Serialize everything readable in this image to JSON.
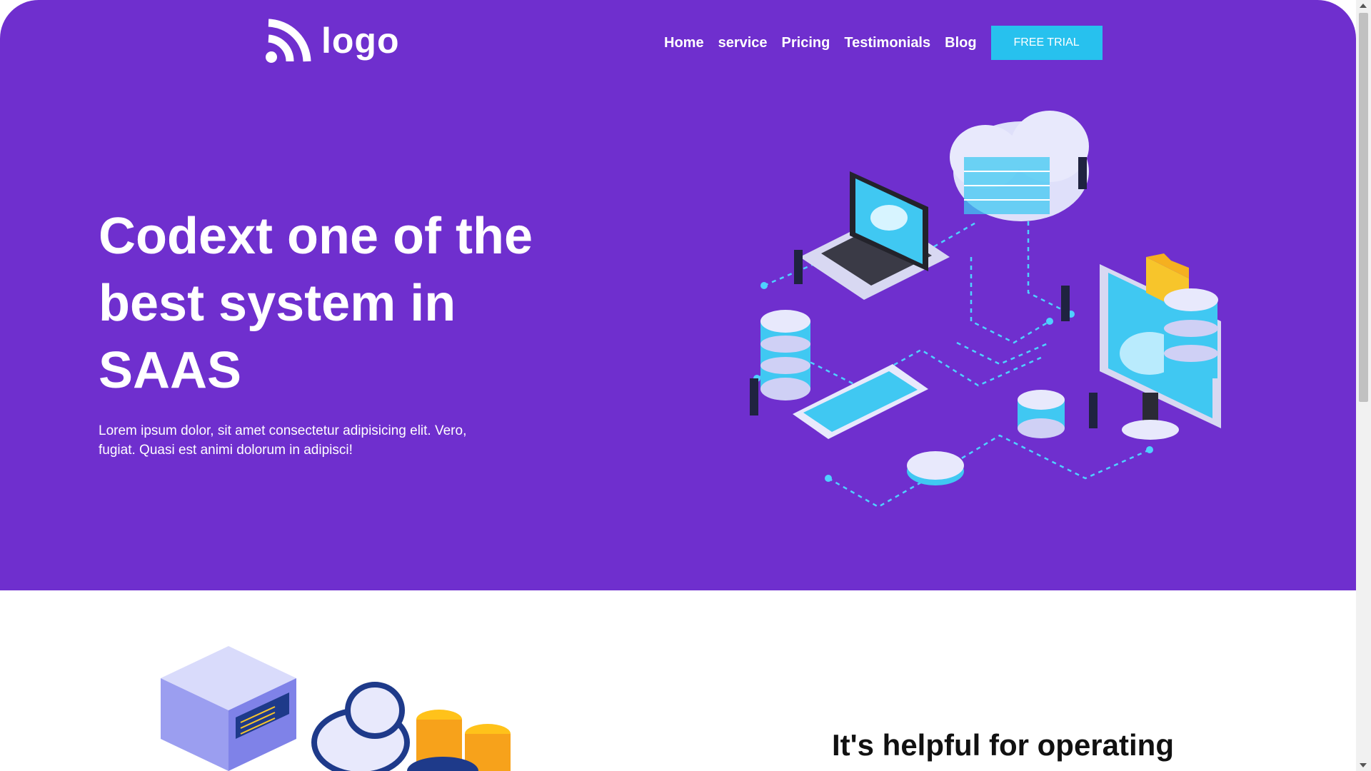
{
  "header": {
    "logo_text": "logo",
    "nav": [
      {
        "label": "Home"
      },
      {
        "label": "service"
      },
      {
        "label": "Pricing"
      },
      {
        "label": "Testimonials"
      },
      {
        "label": "Blog"
      }
    ],
    "cta_label": "FREE TRIAL"
  },
  "hero": {
    "headline": "Codext one of the best system in SAAS",
    "subtext": "Lorem ipsum dolor, sit amet consectetur adipisicing elit. Vero, fugiat. Quasi est animi dolorum in adipisci!"
  },
  "section2": {
    "title": "It's helpful for operating"
  },
  "colors": {
    "brand": "#6f2fce",
    "accent": "#27c1ee",
    "illustration_primary": "#40c8f2",
    "folder": "#f7c52b"
  }
}
